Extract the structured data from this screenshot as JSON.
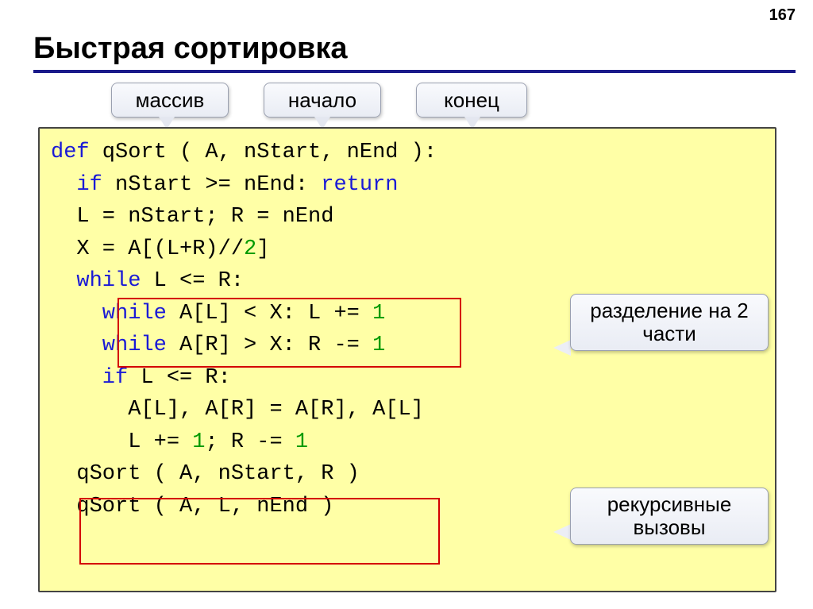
{
  "page_number": "167",
  "title": "Быстрая сортировка",
  "callouts": {
    "array": "массив",
    "start": "начало",
    "end": "конец",
    "split": "разделение\nна 2 части",
    "recurse": "рекурсивные\nвызовы"
  },
  "code": {
    "l1_def": "def",
    "l1_rest": " qSort ( A, nStart, nEnd ):",
    "l2_if": "  if",
    "l2_cond": " nStart >= nEnd: ",
    "l2_ret": "return",
    "l3": "  L = nStart; R = nEnd",
    "l4a": "  X = A[(L+R)//",
    "l4n": "2",
    "l4b": "]",
    "l5w": "  while",
    "l5r": " L <= R:",
    "l6w": "    while",
    "l6mid": " A[L] < X: L += ",
    "l6n": "1",
    "l7w": "    while",
    "l7mid": " A[R] > X: R -= ",
    "l7n": "1",
    "l8if": "    if",
    "l8r": " L <= R:",
    "l9": "      A[L], A[R] = A[R], A[L]",
    "l10a": "      L += ",
    "l10n1": "1",
    "l10b": "; R -= ",
    "l10n2": "1",
    "l11": "  qSort ( A, nStart, R )",
    "l12": "  qSort ( A, L, nEnd )"
  }
}
